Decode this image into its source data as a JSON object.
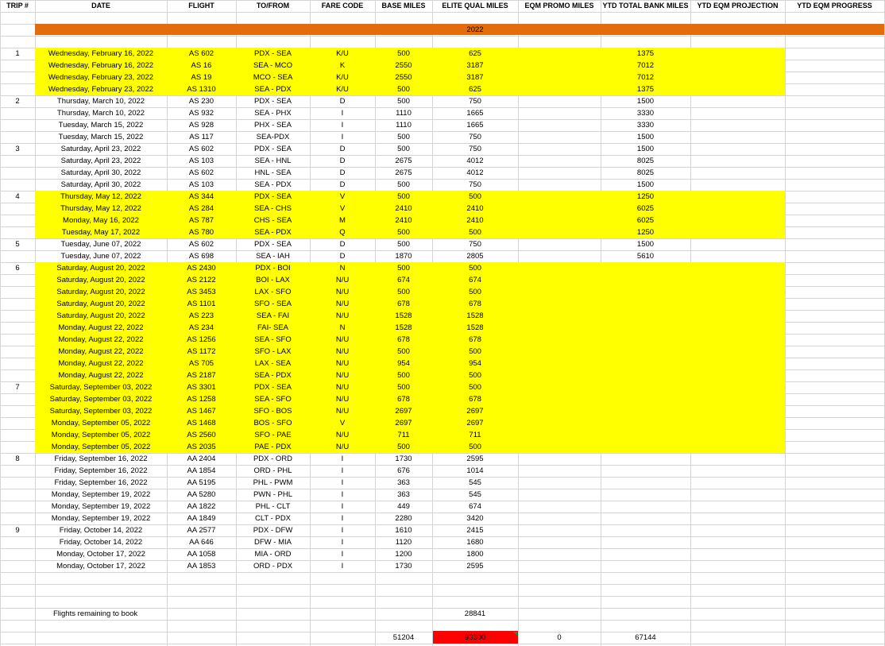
{
  "sheet": {
    "columns": [
      "TRIP #",
      "DATE",
      "FLIGHT",
      "TO/FROM",
      "FARE CODE",
      "BASE MILES",
      "ELITE QUAL MILES",
      "EQM PROMO MILES",
      "YTD TOTAL BANK MILES",
      "YTD EQM PROJECTION",
      "YTD EQM PROGRESS"
    ],
    "year_band": {
      "label": "2022",
      "color": "#e46c0a"
    },
    "highlight_color": "#ffff00",
    "rows": [
      {
        "trip": "1",
        "date": "Wednesday, February 16, 2022",
        "flight": "AS 602",
        "route": "PDX - SEA",
        "fare": "K/U",
        "base": "500",
        "eqm": "625",
        "bank": "1375",
        "hl": true
      },
      {
        "trip": "",
        "date": "Wednesday, February 16, 2022",
        "flight": "AS 16",
        "route": "SEA - MCO",
        "fare": "K",
        "base": "2550",
        "eqm": "3187",
        "bank": "7012",
        "hl": true
      },
      {
        "trip": "",
        "date": "Wednesday, February 23, 2022",
        "flight": "AS 19",
        "route": "MCO - SEA",
        "fare": "K/U",
        "base": "2550",
        "eqm": "3187",
        "bank": "7012",
        "hl": true
      },
      {
        "trip": "",
        "date": "Wednesday, February 23, 2022",
        "flight": "AS 1310",
        "route": "SEA - PDX",
        "fare": "K/U",
        "base": "500",
        "eqm": "625",
        "bank": "1375",
        "hl": true
      },
      {
        "trip": "2",
        "date": "Thursday, March 10, 2022",
        "flight": "AS 230",
        "route": "PDX - SEA",
        "fare": "D",
        "base": "500",
        "eqm": "750",
        "bank": "1500",
        "hl": false
      },
      {
        "trip": "",
        "date": "Thursday, March 10, 2022",
        "flight": "AS 932",
        "route": "SEA - PHX",
        "fare": "I",
        "base": "1110",
        "eqm": "1665",
        "bank": "3330",
        "hl": false
      },
      {
        "trip": "",
        "date": "Tuesday, March 15, 2022",
        "flight": "AS 928",
        "route": "PHX - SEA",
        "fare": "I",
        "base": "1110",
        "eqm": "1665",
        "bank": "3330",
        "hl": false
      },
      {
        "trip": "",
        "date": "Tuesday, March 15, 2022",
        "flight": "AS 117",
        "route": "SEA-PDX",
        "fare": "I",
        "base": "500",
        "eqm": "750",
        "bank": "1500",
        "hl": false
      },
      {
        "trip": "3",
        "date": "Saturday, April 23, 2022",
        "flight": "AS 602",
        "route": "PDX - SEA",
        "fare": "D",
        "base": "500",
        "eqm": "750",
        "bank": "1500",
        "hl": false
      },
      {
        "trip": "",
        "date": "Saturday, April 23, 2022",
        "flight": "AS 103",
        "route": "SEA - HNL",
        "fare": "D",
        "base": "2675",
        "eqm": "4012",
        "bank": "8025",
        "hl": false
      },
      {
        "trip": "",
        "date": "Saturday, April 30, 2022",
        "flight": "AS 602",
        "route": "HNL - SEA",
        "fare": "D",
        "base": "2675",
        "eqm": "4012",
        "bank": "8025",
        "hl": false
      },
      {
        "trip": "",
        "date": "Saturday, April 30, 2022",
        "flight": "AS 103",
        "route": "SEA - PDX",
        "fare": "D",
        "base": "500",
        "eqm": "750",
        "bank": "1500",
        "hl": false
      },
      {
        "trip": "4",
        "date": "Thursday, May 12, 2022",
        "flight": "AS 344",
        "route": "PDX - SEA",
        "fare": "V",
        "base": "500",
        "eqm": "500",
        "bank": "1250",
        "hl": true
      },
      {
        "trip": "",
        "date": "Thursday, May 12, 2022",
        "flight": "AS 284",
        "route": "SEA - CHS",
        "fare": "V",
        "base": "2410",
        "eqm": "2410",
        "bank": "6025",
        "hl": true
      },
      {
        "trip": "",
        "date": "Monday, May 16, 2022",
        "flight": "AS 787",
        "route": "CHS - SEA",
        "fare": "M",
        "base": "2410",
        "eqm": "2410",
        "bank": "6025",
        "hl": true
      },
      {
        "trip": "",
        "date": "Tuesday, May 17, 2022",
        "flight": "AS 780",
        "route": "SEA - PDX",
        "fare": "Q",
        "base": "500",
        "eqm": "500",
        "bank": "1250",
        "hl": true
      },
      {
        "trip": "5",
        "date": "Tuesday, June 07, 2022",
        "flight": "AS 602",
        "route": "PDX - SEA",
        "fare": "D",
        "base": "500",
        "eqm": "750",
        "bank": "1500",
        "hl": false
      },
      {
        "trip": "",
        "date": "Tuesday, June 07, 2022",
        "flight": "AS 698",
        "route": "SEA - IAH",
        "fare": "D",
        "base": "1870",
        "eqm": "2805",
        "bank": "5610",
        "hl": false
      },
      {
        "trip": "6",
        "date": "Saturday, August 20, 2022",
        "flight": "AS 2430",
        "route": "PDX - BOI",
        "fare": "N",
        "base": "500",
        "eqm": "500",
        "bank": "",
        "hl": true
      },
      {
        "trip": "",
        "date": "Saturday, August 20, 2022",
        "flight": "AS 2122",
        "route": "BOI - LAX",
        "fare": "N/U",
        "base": "674",
        "eqm": "674",
        "bank": "",
        "hl": true
      },
      {
        "trip": "",
        "date": "Saturday, August 20, 2022",
        "flight": "AS 3453",
        "route": "LAX - SFO",
        "fare": "N/U",
        "base": "500",
        "eqm": "500",
        "bank": "",
        "hl": true
      },
      {
        "trip": "",
        "date": "Saturday, August 20, 2022",
        "flight": "AS 1101",
        "route": "SFO - SEA",
        "fare": "N/U",
        "base": "678",
        "eqm": "678",
        "bank": "",
        "hl": true
      },
      {
        "trip": "",
        "date": "Saturday, August 20, 2022",
        "flight": "AS 223",
        "route": "SEA - FAI",
        "fare": "N/U",
        "base": "1528",
        "eqm": "1528",
        "bank": "",
        "hl": true
      },
      {
        "trip": "",
        "date": "Monday, August 22, 2022",
        "flight": "AS 234",
        "route": "FAI- SEA",
        "fare": "N",
        "base": "1528",
        "eqm": "1528",
        "bank": "",
        "hl": true
      },
      {
        "trip": "",
        "date": "Monday, August 22, 2022",
        "flight": "AS 1256",
        "route": "SEA - SFO",
        "fare": "N/U",
        "base": "678",
        "eqm": "678",
        "bank": "",
        "hl": true
      },
      {
        "trip": "",
        "date": "Monday, August 22, 2022",
        "flight": "AS 1172",
        "route": "SFO - LAX",
        "fare": "N/U",
        "base": "500",
        "eqm": "500",
        "bank": "",
        "hl": true
      },
      {
        "trip": "",
        "date": "Monday, August 22, 2022",
        "flight": "AS 705",
        "route": "LAX - SEA",
        "fare": "N/U",
        "base": "954",
        "eqm": "954",
        "bank": "",
        "hl": true
      },
      {
        "trip": "",
        "date": "Monday, August 22, 2022",
        "flight": "AS 2187",
        "route": "SEA - PDX",
        "fare": "N/U",
        "base": "500",
        "eqm": "500",
        "bank": "",
        "hl": true
      },
      {
        "trip": "7",
        "date": "Saturday, September 03, 2022",
        "flight": "AS 3301",
        "route": "PDX - SEA",
        "fare": "N/U",
        "base": "500",
        "eqm": "500",
        "bank": "",
        "hl": true
      },
      {
        "trip": "",
        "date": "Saturday, September 03, 2022",
        "flight": "AS 1258",
        "route": "SEA - SFO",
        "fare": "N/U",
        "base": "678",
        "eqm": "678",
        "bank": "",
        "hl": true
      },
      {
        "trip": "",
        "date": "Saturday, September 03, 2022",
        "flight": "AS 1467",
        "route": "SFO - BOS",
        "fare": "N/U",
        "base": "2697",
        "eqm": "2697",
        "bank": "",
        "hl": true
      },
      {
        "trip": "",
        "date": "Monday, September 05, 2022",
        "flight": "AS 1468",
        "route": "BOS - SFO",
        "fare": "V",
        "base": "2697",
        "eqm": "2697",
        "bank": "",
        "hl": true
      },
      {
        "trip": "",
        "date": "Monday, September 05, 2022",
        "flight": "AS 2560",
        "route": "SFO - PAE",
        "fare": "N/U",
        "base": "711",
        "eqm": "711",
        "bank": "",
        "hl": true
      },
      {
        "trip": "",
        "date": "Monday, September 05, 2022",
        "flight": "AS 2035",
        "route": "PAE - PDX",
        "fare": "N/U",
        "base": "500",
        "eqm": "500",
        "bank": "",
        "hl": true
      },
      {
        "trip": "8",
        "date": "Friday, September 16, 2022",
        "flight": "AA 2404",
        "route": "PDX - ORD",
        "fare": "I",
        "base": "1730",
        "eqm": "2595",
        "bank": "",
        "hl": false
      },
      {
        "trip": "",
        "date": "Friday, September 16, 2022",
        "flight": "AA 1854",
        "route": "ORD - PHL",
        "fare": "I",
        "base": "676",
        "eqm": "1014",
        "bank": "",
        "hl": false
      },
      {
        "trip": "",
        "date": "Friday, September 16, 2022",
        "flight": "AA 5195",
        "route": "PHL - PWM",
        "fare": "I",
        "base": "363",
        "eqm": "545",
        "bank": "",
        "hl": false
      },
      {
        "trip": "",
        "date": "Monday, September 19, 2022",
        "flight": "AA 5280",
        "route": "PWN - PHL",
        "fare": "I",
        "base": "363",
        "eqm": "545",
        "bank": "",
        "hl": false
      },
      {
        "trip": "",
        "date": "Monday, September 19, 2022",
        "flight": "AA 1822",
        "route": "PHL - CLT",
        "fare": "I",
        "base": "449",
        "eqm": "674",
        "bank": "",
        "hl": false
      },
      {
        "trip": "",
        "date": "Monday, September 19, 2022",
        "flight": "AA 1849",
        "route": "CLT - PDX",
        "fare": "I",
        "base": "2280",
        "eqm": "3420",
        "bank": "",
        "hl": false
      },
      {
        "trip": "9",
        "date": "Friday, October 14, 2022",
        "flight": "AA 2577",
        "route": "PDX - DFW",
        "fare": "I",
        "base": "1610",
        "eqm": "2415",
        "bank": "",
        "hl": false
      },
      {
        "trip": "",
        "date": "Friday, October 14, 2022",
        "flight": "AA 646",
        "route": "DFW - MIA",
        "fare": "I",
        "base": "1120",
        "eqm": "1680",
        "bank": "",
        "hl": false
      },
      {
        "trip": "",
        "date": "Monday, October 17, 2022",
        "flight": "AA 1058",
        "route": "MIA - ORD",
        "fare": "I",
        "base": "1200",
        "eqm": "1800",
        "bank": "",
        "hl": false
      },
      {
        "trip": "",
        "date": "Monday, October 17, 2022",
        "flight": "AA 1853",
        "route": "ORD - PDX",
        "fare": "I",
        "base": "1730",
        "eqm": "2595",
        "bank": "",
        "hl": false
      }
    ],
    "remaining": {
      "label": "Flights remaining to book",
      "eqm": "28841"
    },
    "totals": {
      "base": "51204",
      "eqm": "93300",
      "promo": "0",
      "bank": "67144",
      "eqm_fill": "#ff0000"
    }
  }
}
